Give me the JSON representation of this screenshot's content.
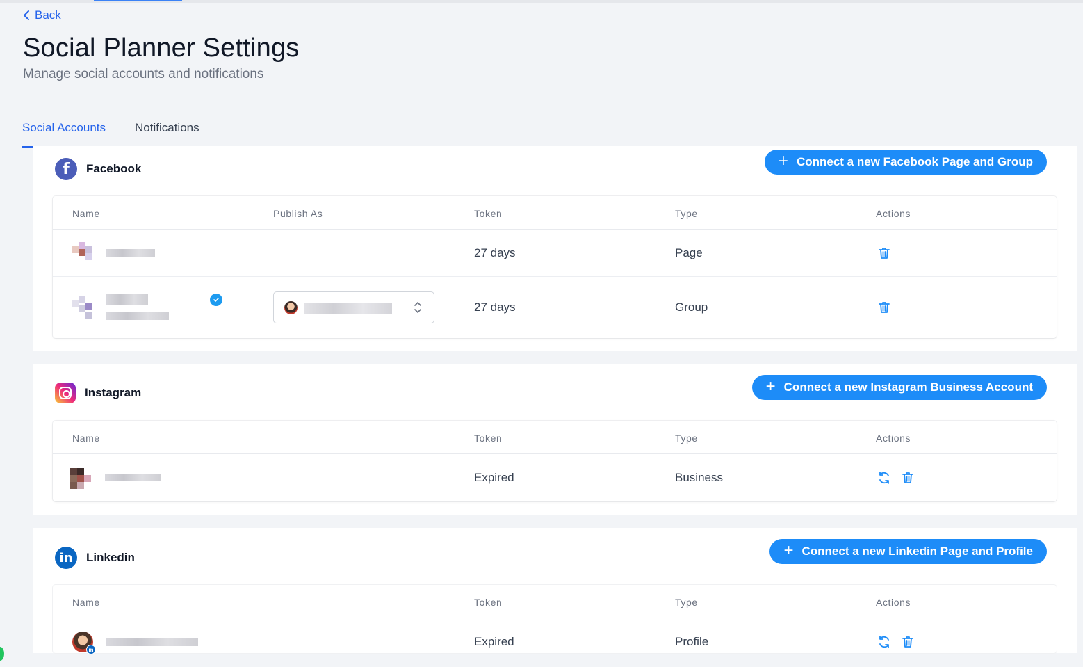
{
  "header": {
    "back_label": "Back",
    "title": "Social Planner Settings",
    "subtitle": "Manage social accounts and notifications"
  },
  "tabs": [
    {
      "label": "Social Accounts",
      "active": true
    },
    {
      "label": "Notifications",
      "active": false
    }
  ],
  "colors": {
    "accent": "#2563eb",
    "button": "#1d8cf8",
    "facebook": "#4b5db8",
    "linkedin": "#0a66c2"
  },
  "facebook": {
    "name": "Facebook",
    "connect_label": "Connect a new Facebook Page and Group",
    "columns": [
      "Name",
      "Publish As",
      "Token",
      "Type",
      "Actions"
    ],
    "rows": [
      {
        "token": "27 days",
        "type": "Page",
        "actions": [
          "trash-icon"
        ]
      },
      {
        "token": "27 days",
        "type": "Group",
        "verified": true,
        "actions": [
          "trash-icon"
        ]
      }
    ]
  },
  "instagram": {
    "name": "Instagram",
    "connect_label": "Connect a new Instagram Business Account",
    "columns": [
      "Name",
      "Token",
      "Type",
      "Actions"
    ],
    "rows": [
      {
        "token": "Expired",
        "type": "Business",
        "actions": [
          "refresh-icon",
          "trash-icon"
        ]
      }
    ]
  },
  "linkedin": {
    "name": "Linkedin",
    "connect_label": "Connect a new Linkedin Page and Profile",
    "columns": [
      "Name",
      "Token",
      "Type",
      "Actions"
    ],
    "rows": [
      {
        "token": "Expired",
        "type": "Profile",
        "actions": [
          "refresh-icon",
          "trash-icon"
        ]
      }
    ]
  }
}
